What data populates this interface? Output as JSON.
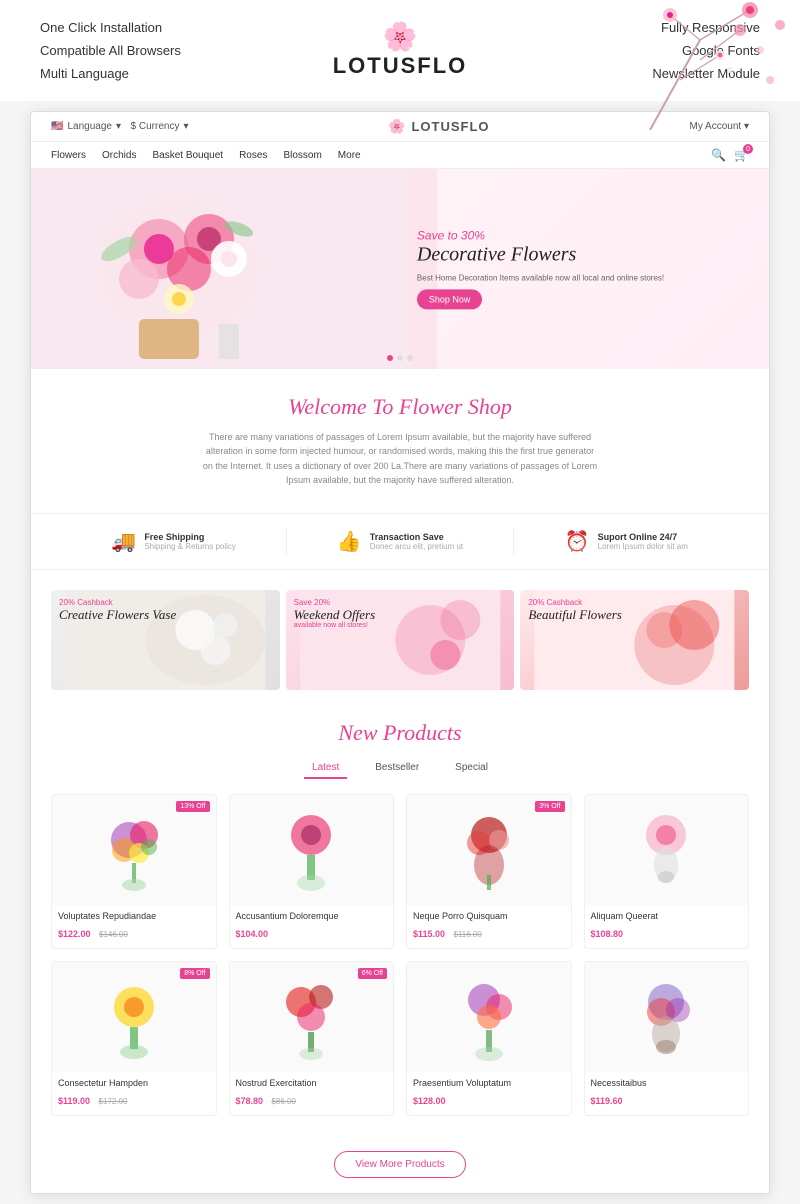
{
  "header": {
    "left_items": [
      "One Click Installation",
      "Compatible All Browsers",
      "Multi Language"
    ],
    "logo_icon": "🌸",
    "logo_text": "LOTUSFLO",
    "right_items": [
      "Fully Responsive",
      "Google Fonts",
      "Newsletter Module"
    ]
  },
  "site": {
    "topbar": {
      "language": "Language",
      "currency": "$ Currency",
      "account": "My Account"
    },
    "nav": {
      "items": [
        "Flowers",
        "Orchids",
        "Basket Bouquet",
        "Roses",
        "Blossom",
        "More"
      ]
    },
    "hero": {
      "save_text": "Save to 30%",
      "title": "Decorative Flowers",
      "desc": "Best Home Decoration Items available now\nall local and online stores!",
      "btn": "Shop Now"
    },
    "welcome": {
      "title": "Welcome To Flower Shop",
      "desc": "There are many variations of passages of Lorem Ipsum available, but the majority have suffered alteration in some form injected humour, or randomised words, making this the first true generator on the Internet. It uses a dictionary of over 200 La.There are many variations of passages of Lorem Ipsum available, but the majority have suffered alteration."
    },
    "features": [
      {
        "icon": "🚚",
        "title": "Free Shipping",
        "desc": "Shipping & Returns policy"
      },
      {
        "icon": "👍",
        "title": "Transaction Save",
        "desc": "Donec arcu elit, pretium ut"
      },
      {
        "icon": "⏰",
        "title": "Suport Online 24/7",
        "desc": "Lorem Ipsum dolor sit am"
      }
    ],
    "promos": [
      {
        "tag": "20% Cashback",
        "name": "Creative Flowers Vase"
      },
      {
        "tag": "Save 20%",
        "name": "Weekend Offers",
        "sub": "available now all stores!"
      },
      {
        "tag": "20% Cashback",
        "name": "Beautiful Flowers"
      }
    ],
    "products": {
      "section_title": "New Products",
      "tabs": [
        "Latest",
        "Bestseller",
        "Special"
      ],
      "active_tab": "Latest",
      "items": [
        {
          "name": "Voluptates Repudiandae",
          "price": "$122.00",
          "old_price": "$146.00",
          "badge": "13% Off",
          "emoji": "💐"
        },
        {
          "name": "Accusantium Doloremque",
          "price": "$104.00",
          "badge": "",
          "emoji": "🌸"
        },
        {
          "name": "Neque Porro Quisquam",
          "price": "$115.00",
          "old_price": "$116.00",
          "badge": "3% Off",
          "emoji": "🌹"
        },
        {
          "name": "Aliquam Queerat",
          "price": "$108.80",
          "badge": "",
          "emoji": "🌷"
        },
        {
          "name": "Consectetur Hampden",
          "price": "$119.00",
          "old_price": "$172.00",
          "badge": "8% Off",
          "emoji": "🌻"
        },
        {
          "name": "Nostrud Exercitation",
          "price": "$78.80",
          "old_price": "$86.00",
          "badge": "6% Off",
          "emoji": "🌺"
        },
        {
          "name": "Praesentium Voluptatum",
          "price": "$128.00",
          "badge": "",
          "emoji": "💮"
        },
        {
          "name": "Necessitaibus",
          "price": "$119.60",
          "badge": "",
          "emoji": "🌼"
        }
      ],
      "view_more_btn": "View More Products"
    }
  }
}
